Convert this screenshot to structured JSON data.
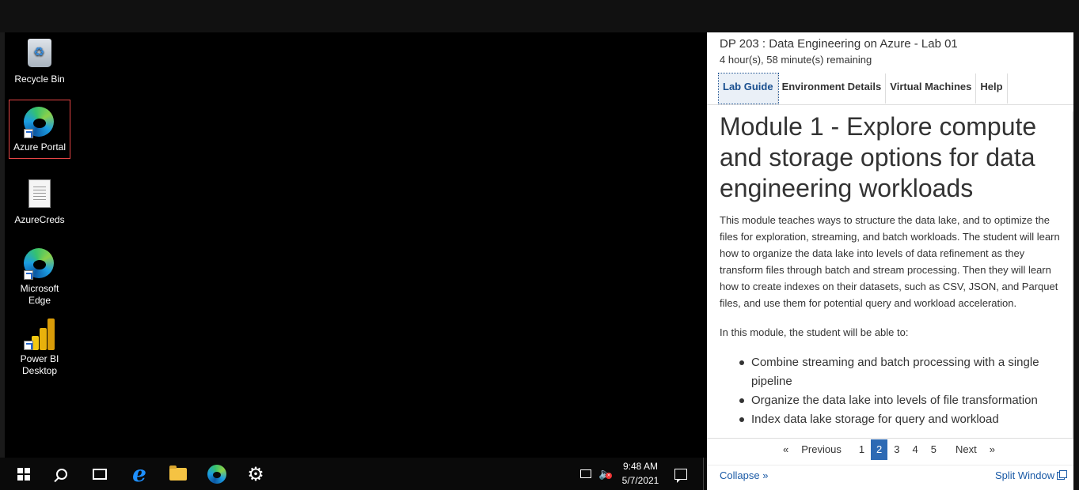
{
  "desktop": {
    "icons": [
      {
        "label": "Recycle Bin",
        "icon": "recycle-bin-icon"
      },
      {
        "label": "Azure Portal",
        "icon": "edge-icon"
      },
      {
        "label": "AzureCreds",
        "icon": "text-file-icon"
      },
      {
        "label": "Microsoft Edge",
        "icon": "edge-icon"
      },
      {
        "label": "Power BI Desktop",
        "icon": "power-bi-icon"
      }
    ]
  },
  "taskbar": {
    "buttons": [
      "start-icon",
      "search-icon",
      "task-view-icon",
      "internet-explorer-icon",
      "file-explorer-icon",
      "edge-icon",
      "settings-icon"
    ],
    "clock": {
      "time": "9:48 AM",
      "date": "5/7/2021"
    }
  },
  "lab": {
    "title": "DP 203 : Data Engineering on Azure - Lab 01",
    "time_remaining": "4 hour(s), 58 minute(s) remaining",
    "tabs": [
      "Lab Guide",
      "Environment Details",
      "Virtual Machines",
      "Help"
    ],
    "active_tab": "Lab Guide",
    "heading": "Module 1 - Explore compute and storage options for data engineering workloads",
    "intro": "This module teaches ways to structure the data lake, and to optimize the files for exploration, streaming, and batch workloads. The student will learn how to organize the data lake into levels of data refinement as they transform files through batch and stream processing. Then they will learn how to create indexes on their datasets, such as CSV, JSON, and Parquet files, and use them for potential query and workload acceleration.",
    "objectives_intro": "In this module, the student will be able to:",
    "objectives": [
      "Combine streaming and batch processing with a single pipeline",
      "Organize the data lake into levels of file transformation",
      "Index data lake storage for query and workload"
    ],
    "pager": {
      "first": "«",
      "previous": "Previous",
      "pages": [
        "1",
        "2",
        "3",
        "4",
        "5"
      ],
      "current": "2",
      "next": "Next",
      "last": "»"
    },
    "collapse": "Collapse »",
    "split_window": "Split Window"
  },
  "colors": {
    "accent": "#2d6ab4",
    "link": "#1a5aa6",
    "selection": "#e64545"
  }
}
